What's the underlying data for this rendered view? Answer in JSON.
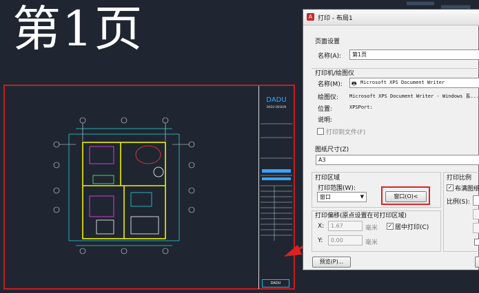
{
  "page_heading": "第1页",
  "title_block": {
    "brand": "DADU",
    "subtitle": "DADU DESIGN",
    "bottom": "DADU"
  },
  "dialog": {
    "title": "打印 - 布局1",
    "page_setup": {
      "group_label": "页面设置",
      "name_label": "名称(A):",
      "name_value": "第1页"
    },
    "printer": {
      "group_label": "打印机/绘图仪",
      "name_label": "名称(M):",
      "name_value": "Microsoft XPS Document Writer",
      "plotter_label": "绘图仪:",
      "plotter_value": "Microsoft XPS Document Writer - Windows 系...",
      "location_label": "位置:",
      "location_value": "XPSPort:",
      "description_label": "说明:",
      "print_to_file_label": "打印到文件(F)"
    },
    "paper_size": {
      "group_label": "图纸尺寸(Z)",
      "value": "A3"
    },
    "plot_area": {
      "group_label": "打印区域",
      "range_label": "打印范围(W):",
      "range_value": "窗口",
      "window_button": "窗口(O)<"
    },
    "plot_offset": {
      "group_label": "打印偏移(原点设置在可打印区域)",
      "x_label": "X:",
      "x_value": "1.67",
      "x_unit": "毫米",
      "y_label": "Y:",
      "y_value": "0.00",
      "y_unit": "毫米",
      "center_label": "居中打印(C)"
    },
    "plot_scale": {
      "group_label": "打印比例",
      "fit_label": "布满图纸",
      "scale_label": "比例(S):"
    },
    "preview_button": "预览(P)..."
  }
}
